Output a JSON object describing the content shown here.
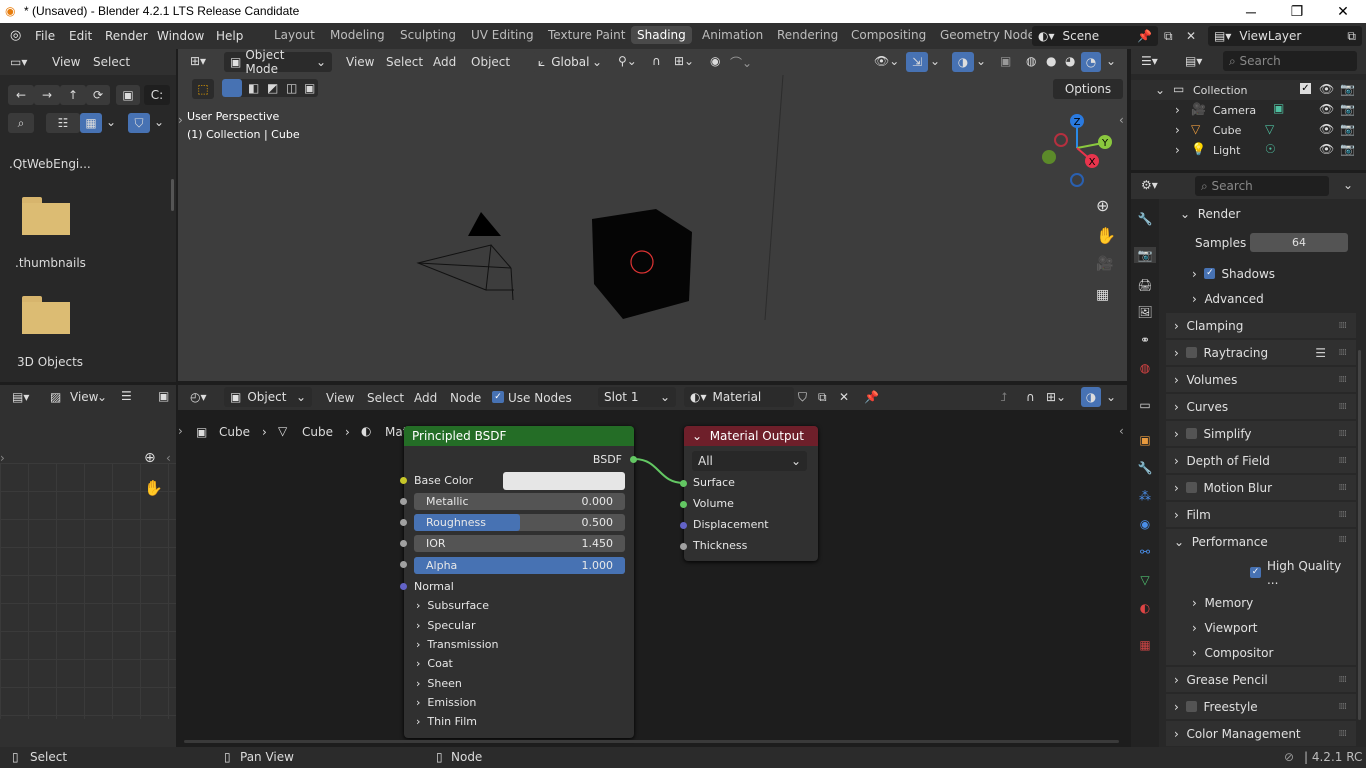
{
  "window": {
    "title": "* (Unsaved) - Blender 4.2.1 LTS Release Candidate",
    "minimize": "─",
    "maximize": "❐",
    "close": "✕"
  },
  "menu": [
    "File",
    "Edit",
    "Render",
    "Window",
    "Help"
  ],
  "workspaces": [
    "Layout",
    "Modeling",
    "Sculpting",
    "UV Editing",
    "Texture Paint",
    "Shading",
    "Animation",
    "Rendering",
    "Compositing",
    "Geometry Node"
  ],
  "active_workspace": "Shading",
  "scene": {
    "scene_name": "Scene",
    "view_layer": "ViewLayer"
  },
  "file_browser": {
    "view": "View",
    "select": "Select",
    "path": "C:",
    "items": [
      ".QtWebEngi...",
      ".thumbnails",
      "3D Objects"
    ]
  },
  "viewport": {
    "mode": "Object Mode",
    "menus": [
      "View",
      "Select",
      "Add",
      "Object"
    ],
    "orientation": "Global",
    "options": "Options",
    "info_line1": "User Perspective",
    "info_line2": "(1) Collection | Cube"
  },
  "image_editor": {
    "view": "View"
  },
  "node_editor": {
    "mode": "Object",
    "menus": [
      "View",
      "Select",
      "Add",
      "Node"
    ],
    "use_nodes": "Use Nodes",
    "slot": "Slot 1",
    "material": "Material",
    "breadcrumb": [
      "Cube",
      "Cube",
      "Material"
    ]
  },
  "principled": {
    "title": "Principled BSDF",
    "output": "BSDF",
    "base_color": "Base Color",
    "fields": [
      {
        "label": "Metallic",
        "value": "0.000",
        "fill": 0.0
      },
      {
        "label": "Roughness",
        "value": "0.500",
        "fill": 0.5
      },
      {
        "label": "IOR",
        "value": "1.450",
        "fill": 0.0
      },
      {
        "label": "Alpha",
        "value": "1.000",
        "fill": 1.0
      }
    ],
    "normal": "Normal",
    "panels": [
      "Subsurface",
      "Specular",
      "Transmission",
      "Coat",
      "Sheen",
      "Emission",
      "Thin Film"
    ]
  },
  "material_output": {
    "title": "Material Output",
    "target": "All",
    "inputs": [
      "Surface",
      "Volume",
      "Displacement",
      "Thickness"
    ]
  },
  "outliner": {
    "search": "Search",
    "items": [
      {
        "name": "Collection"
      },
      {
        "name": "Camera"
      },
      {
        "name": "Cube"
      },
      {
        "name": "Light"
      }
    ]
  },
  "properties": {
    "search": "Search",
    "render_section": "Render",
    "samples_label": "Samples",
    "samples_value": "64",
    "shadows": "Shadows",
    "advanced": "Advanced",
    "sections": [
      "Clamping",
      "Raytracing",
      "Volumes",
      "Curves",
      "Simplify",
      "Depth of Field",
      "Motion Blur",
      "Film",
      "Performance"
    ],
    "high_quality": "High Quality ...",
    "perf_sub": [
      "Memory",
      "Viewport",
      "Compositor"
    ],
    "bottom_sections": [
      "Grease Pencil",
      "Freestyle",
      "Color Management"
    ]
  },
  "status": {
    "select": "Select",
    "pan": "Pan View",
    "node": "Node",
    "version": "4.2.1 RC"
  }
}
